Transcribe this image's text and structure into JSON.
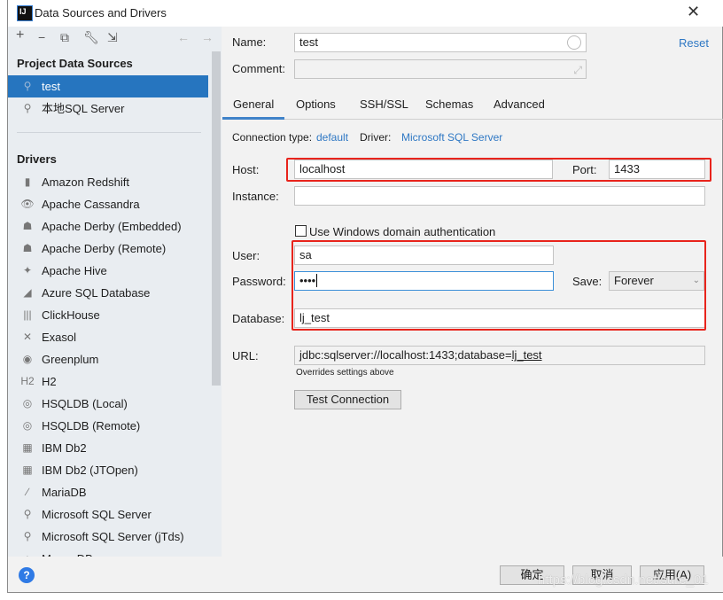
{
  "window": {
    "title": "Data Sources and Drivers",
    "logo": "IJ"
  },
  "toolbar": {
    "icons": [
      "plus-icon",
      "minus-icon",
      "copy-icon",
      "wrench-icon",
      "import-icon",
      "back-arrow-icon",
      "forward-arrow-icon"
    ]
  },
  "sidebar": {
    "project_header": "Project Data Sources",
    "project_items": [
      {
        "label": "test",
        "selected": true
      },
      {
        "label": "本地SQL Server",
        "selected": false
      }
    ],
    "drivers_header": "Drivers",
    "drivers": [
      {
        "label": "Amazon Redshift",
        "icon": "▮"
      },
      {
        "label": "Apache Cassandra",
        "icon": "👁"
      },
      {
        "label": "Apache Derby (Embedded)",
        "icon": "☗"
      },
      {
        "label": "Apache Derby (Remote)",
        "icon": "☗"
      },
      {
        "label": "Apache Hive",
        "icon": "✦"
      },
      {
        "label": "Azure SQL Database",
        "icon": "◢"
      },
      {
        "label": "ClickHouse",
        "icon": "|||"
      },
      {
        "label": "Exasol",
        "icon": "✕"
      },
      {
        "label": "Greenplum",
        "icon": "◉"
      },
      {
        "label": "H2",
        "icon": "H2"
      },
      {
        "label": "HSQLDB (Local)",
        "icon": "◎"
      },
      {
        "label": "HSQLDB (Remote)",
        "icon": "◎"
      },
      {
        "label": "IBM Db2",
        "icon": "▦"
      },
      {
        "label": "IBM Db2 (JTOpen)",
        "icon": "▦"
      },
      {
        "label": "MariaDB",
        "icon": "∕"
      },
      {
        "label": "Microsoft SQL Server",
        "icon": "⚲"
      },
      {
        "label": "Microsoft SQL Server (jTds)",
        "icon": "⚲"
      },
      {
        "label": "MongoDB",
        "icon": "▲"
      }
    ]
  },
  "form": {
    "name_label": "Name:",
    "name_value": "test",
    "reset": "Reset",
    "comment_label": "Comment:",
    "comment_value": "",
    "tabs": [
      {
        "label": "General",
        "active": true
      },
      {
        "label": "Options"
      },
      {
        "label": "SSH/SSL"
      },
      {
        "label": "Schemas"
      },
      {
        "label": "Advanced"
      }
    ],
    "conn_type_label": "Connection type:",
    "conn_type_value": "default",
    "driver_label": "Driver:",
    "driver_value": "Microsoft SQL Server",
    "host_label": "Host:",
    "host_value": "localhost",
    "port_label": "Port:",
    "port_value": "1433",
    "instance_label": "Instance:",
    "instance_value": "",
    "windows_auth_label": "Use Windows domain authentication",
    "windows_auth_checked": false,
    "user_label": "User:",
    "user_value": "sa",
    "password_label": "Password:",
    "password_value": "••••",
    "save_label": "Save:",
    "save_value": "Forever",
    "database_label": "Database:",
    "database_value": "lj_test",
    "url_label": "URL:",
    "url_value": "jdbc:sqlserver://localhost:1433;database=",
    "url_db": "lj_test",
    "url_hint": "Overrides settings above",
    "test_connection": "Test Connection"
  },
  "footer": {
    "ok": "确定",
    "cancel": "取消",
    "apply": "应用(A)",
    "help": "?",
    "watermark": "https://blog.csdn.net/sure_01"
  },
  "colors": {
    "accent": "#2675bf",
    "link": "#2f78c4",
    "highlight": "#e8241c"
  }
}
